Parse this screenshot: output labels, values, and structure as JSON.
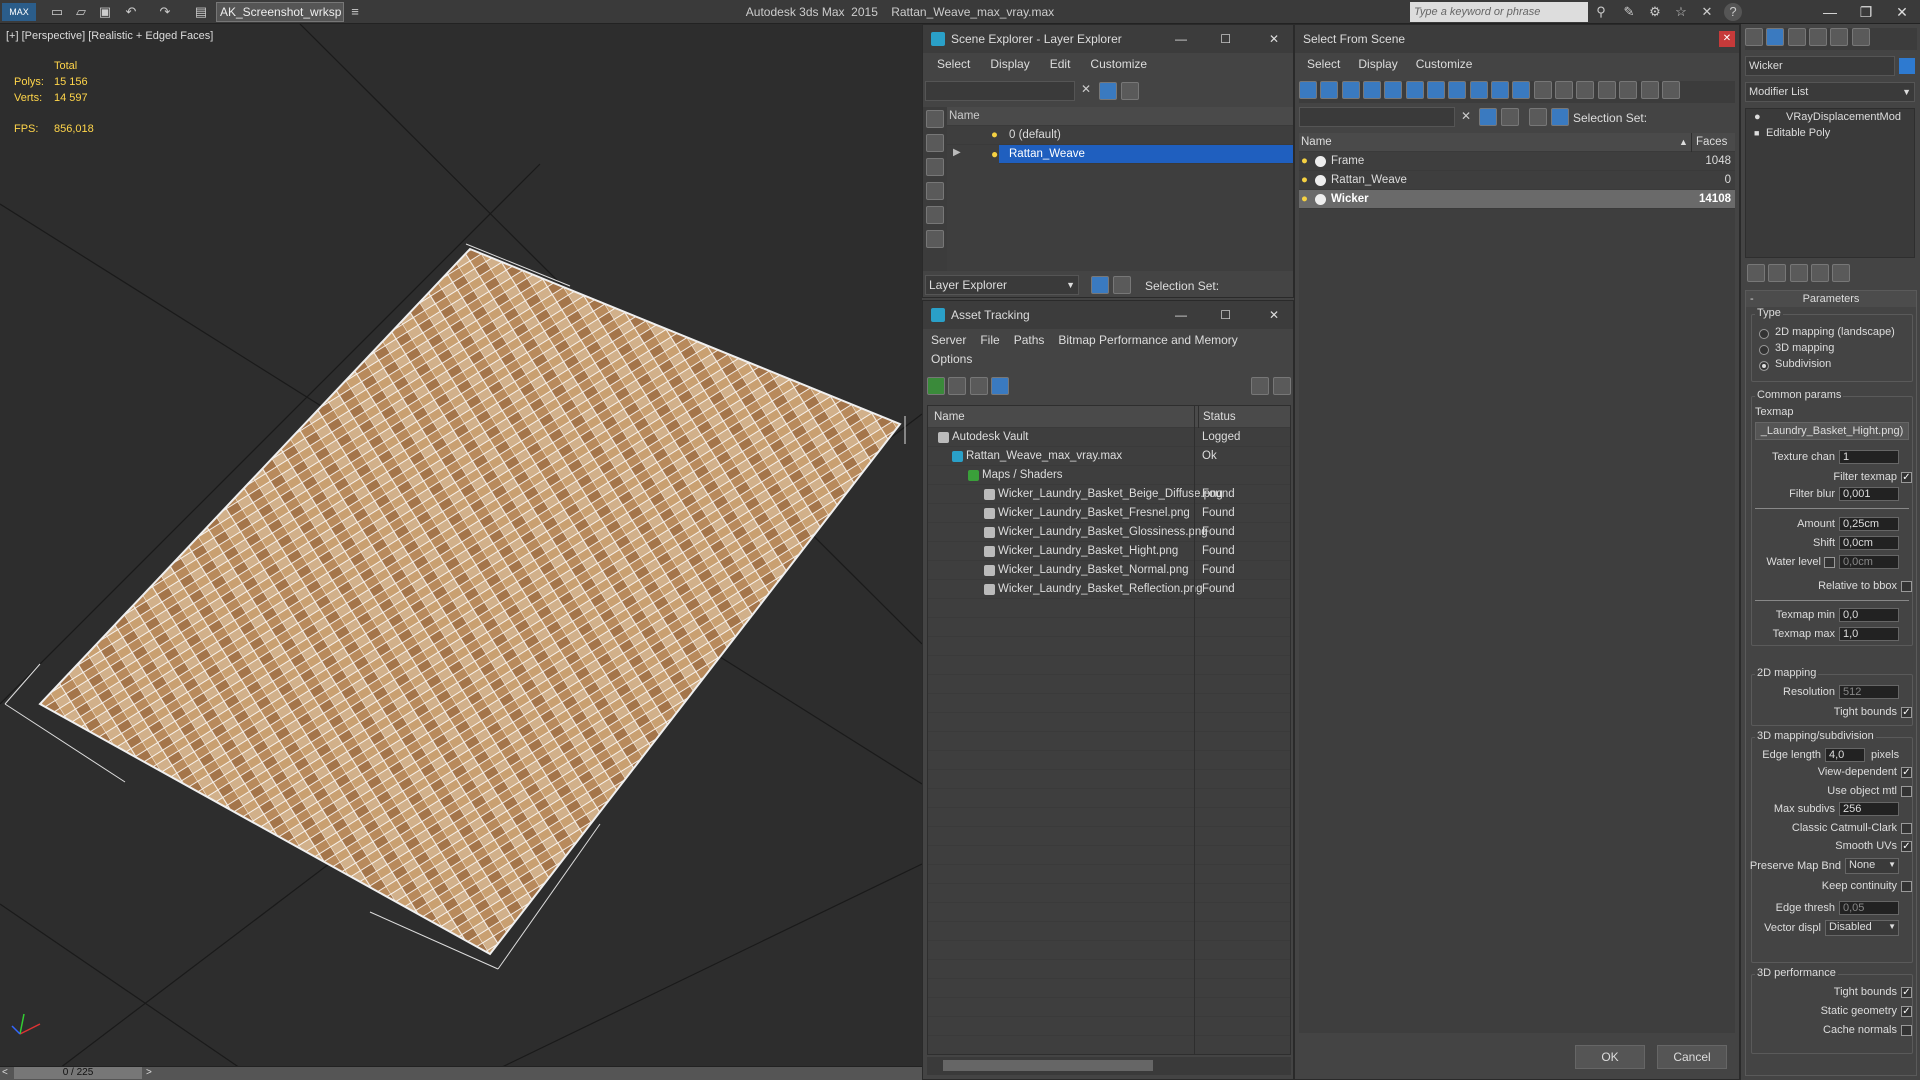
{
  "app": {
    "title": "Autodesk 3ds Max  2015    Rattan_Weave_max_vray.max",
    "workspace": "AK_Screenshot_wrksp",
    "search_placeholder": "Type a keyword or phrase"
  },
  "viewport": {
    "label": "[+] [Perspective] [Realistic + Edged Faces]",
    "stats": {
      "total_label": "Total",
      "polys_label": "Polys:",
      "polys": "15 156",
      "verts_label": "Verts:",
      "verts": "14 597",
      "fps_label": "FPS:",
      "fps": "856,018"
    },
    "frame": "0 / 225"
  },
  "layer_explorer": {
    "title": "Scene Explorer - Layer Explorer",
    "menu": [
      "Select",
      "Display",
      "Edit",
      "Customize"
    ],
    "column": "Name",
    "rows": [
      "0 (default)",
      "Rattan_Weave"
    ],
    "footer_dropdown": "Layer Explorer",
    "selection_set_label": "Selection Set:"
  },
  "asset_tracking": {
    "title": "Asset Tracking",
    "menu": [
      "Server",
      "File",
      "Paths",
      "Bitmap Performance and Memory"
    ],
    "menu2": "Options",
    "col_name": "Name",
    "col_status": "Status",
    "rows": [
      {
        "name": "Autodesk Vault",
        "status": "Logged"
      },
      {
        "name": "Rattan_Weave_max_vray.max",
        "status": "Ok"
      },
      {
        "name": "Maps / Shaders",
        "status": ""
      },
      {
        "name": "Wicker_Laundry_Basket_Beige_Diffuse.png",
        "status": "Found"
      },
      {
        "name": "Wicker_Laundry_Basket_Fresnel.png",
        "status": "Found"
      },
      {
        "name": "Wicker_Laundry_Basket_Glossiness.png",
        "status": "Found"
      },
      {
        "name": "Wicker_Laundry_Basket_Hight.png",
        "status": "Found"
      },
      {
        "name": "Wicker_Laundry_Basket_Normal.png",
        "status": "Found"
      },
      {
        "name": "Wicker_Laundry_Basket_Reflection.png",
        "status": "Found"
      }
    ]
  },
  "select_from_scene": {
    "title": "Select From Scene",
    "menu": [
      "Select",
      "Display",
      "Customize"
    ],
    "selection_set_label": "Selection Set:",
    "col_name": "Name",
    "col_faces": "Faces",
    "rows": [
      {
        "name": "Frame",
        "faces": "1048"
      },
      {
        "name": "Rattan_Weave",
        "faces": "0"
      },
      {
        "name": "Wicker",
        "faces": "14108"
      }
    ],
    "ok": "OK",
    "cancel": "Cancel"
  },
  "command_panel": {
    "object_name": "Wicker",
    "modifier_list": "Modifier List",
    "stack": [
      "VRayDisplacementMod",
      "Editable Poly"
    ],
    "rollout": "Parameters",
    "type_label": "Type",
    "types": [
      "2D mapping (landscape)",
      "3D mapping",
      "Subdivision"
    ],
    "common_label": "Common params",
    "texmap_label": "Texmap",
    "texmap": "_Laundry_Basket_Hight.png)",
    "texture_chan_label": "Texture chan",
    "texture_chan": "1",
    "filter_texmap_label": "Filter texmap",
    "filter_blur_label": "Filter blur",
    "filter_blur": "0,001",
    "amount_label": "Amount",
    "amount": "0,25cm",
    "shift_label": "Shift",
    "shift": "0,0cm",
    "water_label": "Water level",
    "water": "0,0cm",
    "relative_label": "Relative to bbox",
    "texmap_min_label": "Texmap min",
    "texmap_min": "0,0",
    "texmap_max_label": "Texmap max",
    "texmap_max": "1,0",
    "mapping2d_label": "2D mapping",
    "resolution_label": "Resolution",
    "resolution": "512",
    "tight_bounds_label": "Tight bounds",
    "mapping3d_label": "3D mapping/subdivision",
    "edge_length_label": "Edge length",
    "edge_length": "4,0",
    "pixels": "pixels",
    "view_dep_label": "View-dependent",
    "use_obj_label": "Use object mtl",
    "max_subdivs_label": "Max subdivs",
    "max_subdivs": "256",
    "catmull_label": "Classic Catmull-Clark",
    "smooth_uvs_label": "Smooth UVs",
    "preserve_label": "Preserve Map Bnd",
    "preserve": "None",
    "keep_cont_label": "Keep continuity",
    "edge_thresh_label": "Edge thresh",
    "edge_thresh": "0,05",
    "vector_label": "Vector displ",
    "vector": "Disabled",
    "perf_label": "3D performance",
    "perf_tight_label": "Tight bounds",
    "static_geo_label": "Static geometry",
    "cache_normals_label": "Cache normals"
  }
}
